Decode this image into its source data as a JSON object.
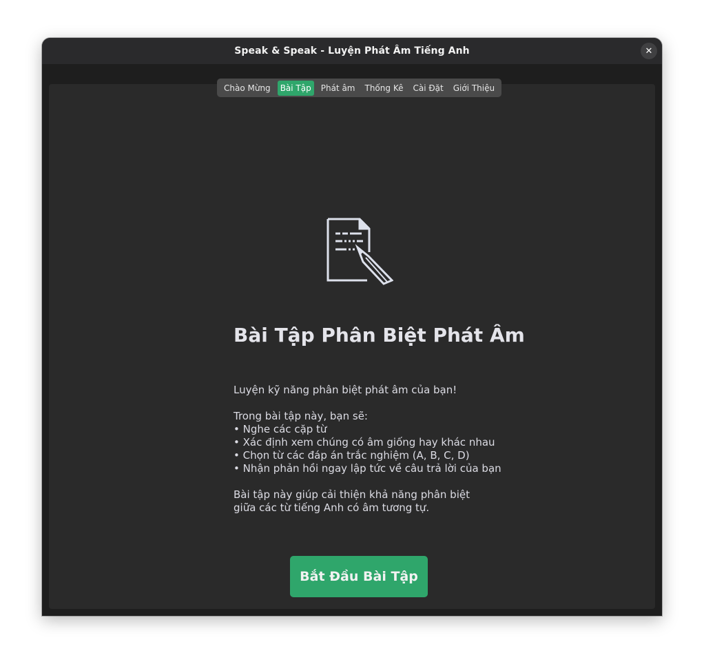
{
  "window": {
    "title": "Speak & Speak - Luyện Phát Âm Tiếng Anh",
    "close_icon": "close-icon",
    "close_glyph": "✕"
  },
  "tabs": [
    {
      "label": "Chào Mừng",
      "active": false
    },
    {
      "label": "Bài Tập",
      "active": true
    },
    {
      "label": "Phát âm",
      "active": false
    },
    {
      "label": "Thống Kê",
      "active": false
    },
    {
      "label": "Cài Đặt",
      "active": false
    },
    {
      "label": "Giới Thiệu",
      "active": false
    }
  ],
  "main": {
    "icon": "document-pencil-icon",
    "heading": "Bài Tập Phân Biệt Phát Âm",
    "intro": "Luyện kỹ năng phân biệt phát âm của bạn!",
    "list_title": "Trong bài tập này, bạn sẽ:",
    "bullets": [
      "• Nghe các cặp từ",
      "• Xác định xem chúng có âm giống hay khác nhau",
      "• Chọn từ các đáp án trắc nghiệm (A, B, C, D)",
      "• Nhận phản hồi ngay lập tức về câu trả lời của bạn"
    ],
    "outro_line1": "Bài tập này giúp cải thiện khả năng phân biệt",
    "outro_line2": "giữa các từ tiếng Anh có âm tương tự.",
    "start_button": "Bắt Đầu Bài Tập"
  },
  "colors": {
    "accent": "#2fa66b",
    "window_bg": "#1e1e1e",
    "panel_bg": "#2a2a2a",
    "titlebar_bg": "#2a2a2c",
    "tabbar_bg": "#4a4a4a",
    "text": "#dcdce4"
  }
}
